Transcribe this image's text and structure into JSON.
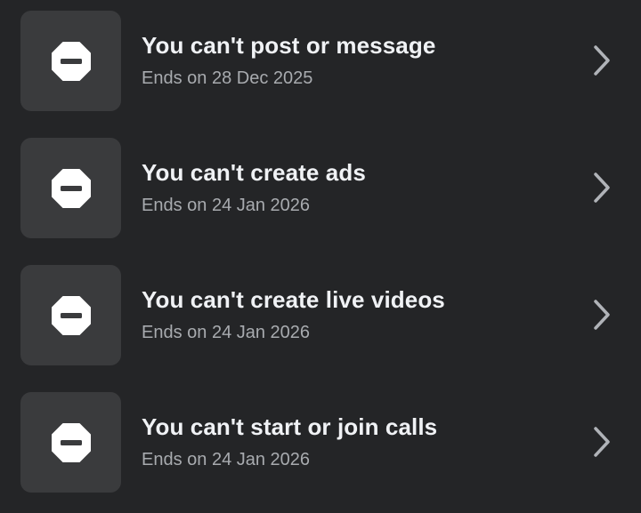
{
  "restrictions": [
    {
      "icon": "no-entry-icon",
      "title": "You can't post or message",
      "subtitle": "Ends on 28 Dec 2025"
    },
    {
      "icon": "no-entry-icon",
      "title": "You can't create ads",
      "subtitle": "Ends on 24 Jan 2026"
    },
    {
      "icon": "no-entry-icon",
      "title": "You can't create live videos",
      "subtitle": "Ends on 24 Jan 2026"
    },
    {
      "icon": "no-entry-icon",
      "title": "You can't start or join calls",
      "subtitle": "Ends on 24 Jan 2026"
    }
  ],
  "colors": {
    "background": "#242527",
    "tile": "#3a3b3d",
    "title": "#f0f2f5",
    "subtitle": "#a8abaf",
    "chevron": "#b0b3b8"
  }
}
